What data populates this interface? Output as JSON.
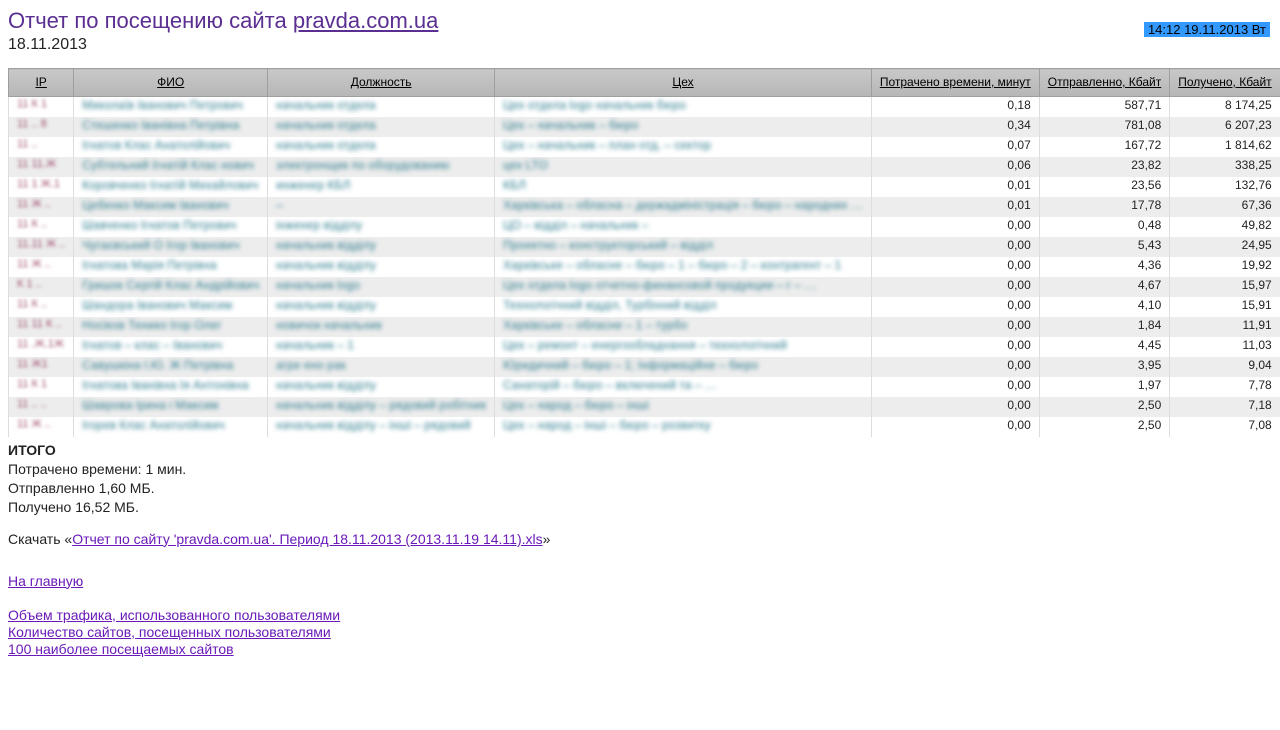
{
  "timestamp": "14:12  19.11.2013  Вт",
  "title_prefix": "Отчет по посещению сайта ",
  "title_site": "pravda.com.ua",
  "report_date": "18.11.2013",
  "columns": {
    "ip": "IP",
    "fio": "ФИО",
    "position": "Должность",
    "department": "Цех",
    "minutes": "Потрачено времени, минут",
    "sent": "Отправленно, Кбайт",
    "recv": "Получено, Кбайт"
  },
  "rows": [
    {
      "ip": "11  К  1",
      "fio": "Миколаїв Іванович Петрович",
      "pos": "начальник отдела",
      "dept": "Цех отдела logo начальник бюро",
      "min": "0,18",
      "sent": "587,71",
      "recv": "8 174,25"
    },
    {
      "ip": "11  ..  8",
      "fio": "Стешенко Іванівна Петрівна",
      "pos": "начальник отдела",
      "dept": "Цех – начальник – бюро",
      "min": "0,34",
      "sent": "781,08",
      "recv": "6 207,23"
    },
    {
      "ip": "11  .. ",
      "fio": "Ігнатов Клас Анатолійович",
      "pos": "начальник отдела",
      "dept": "Цех – начальник – план отд. – сектор",
      "min": "0,07",
      "sent": "167,72",
      "recv": "1 814,62"
    },
    {
      "ip": "11 11.Ж",
      "fio": "Субтельний Ігнатій Клас нович",
      "pos": "электронщик по оборудованию",
      "dept": "цех LTO",
      "min": "0,06",
      "sent": "23,82",
      "recv": "338,25"
    },
    {
      "ip": "11  1  Ж.1",
      "fio": "Коровченко Ігнатій Михайлович",
      "pos": "инженер КБЛ",
      "dept": "КБЛ",
      "min": "0,01",
      "sent": "23,56",
      "recv": "132,76"
    },
    {
      "ip": "11  Ж ..",
      "fio": "Цебенко Максим Іванович",
      "pos": "–",
      "dept": "Харківська – обласна – держадміністрація – бюро – народних …",
      "min": "0,01",
      "sent": "17,78",
      "recv": "67,36"
    },
    {
      "ip": "11  К ..",
      "fio": "Шавченко Ігнатов Петрович",
      "pos": "інженер відділу",
      "dept": "ЦО – відділ – начальник –",
      "min": "0,00",
      "sent": "0,48",
      "recv": "49,82"
    },
    {
      "ip": "11.11 Ж ..",
      "fio": "Чугаєвський О Ігор Іванович",
      "pos": "начальник відділу",
      "dept": "Проектно – конструкторський – відділ",
      "min": "0,00",
      "sent": "5,43",
      "recv": "24,95"
    },
    {
      "ip": "11  Ж ..",
      "fio": "Ігнатова Марія Петрівна",
      "pos": "начальник відділу",
      "dept": "Харківське – обласне – бюро – 1 – бюро – 2 – контрагент – 1",
      "min": "0,00",
      "sent": "4,36",
      "recv": "19,92"
    },
    {
      "ip": "К  1 ..",
      "fio": "Гришок Сергій Клас Андрійович",
      "pos": "начальник logo",
      "dept": "Цех отдела logo отчетно-финансовой продукции – г – …",
      "min": "0,00",
      "sent": "4,67",
      "recv": "15,97"
    },
    {
      "ip": "11  К ..",
      "fio": "Шандора Іванович Максим",
      "pos": "начальник відділу",
      "dept": "Технологічний відділ, Турбінний відділ",
      "min": "0,00",
      "sent": "4,10",
      "recv": "15,91"
    },
    {
      "ip": "11 11 К ..",
      "fio": "Носіков Тенико Ігор Олег",
      "pos": "новичок начальник",
      "dept": "Харківське – обласне – 1 – турбо",
      "min": "0,00",
      "sent": "1,84",
      "recv": "11,91"
    },
    {
      "ip": "11  .Ж.1Ж",
      "fio": "Ігнатов – клас – Іванович",
      "pos": "начальник – 1",
      "dept": "Цех – ремонт – енергообладнання – технологічний",
      "min": "0,00",
      "sent": "4,45",
      "recv": "11,03"
    },
    {
      "ip": "11  Ж1",
      "fio": "Савушкіна І.Ю. Ж Петрівна",
      "pos": "агре ено рак",
      "dept": "Юридичний – бюро – 1; Інформаційне – бюро",
      "min": "0,00",
      "sent": "3,95",
      "recv": "9,04"
    },
    {
      "ip": "11  К  1",
      "fio": "Ігнатова Іванівна Ія Антонівна",
      "pos": "начальник відділу",
      "dept": "Санаторій – бюро – включений та – …",
      "min": "0,00",
      "sent": "1,97",
      "recv": "7,78"
    },
    {
      "ip": "11  .. ..",
      "fio": "Шаврова Ірина і Максим",
      "pos": "начальник відділу – рядовий робітник",
      "dept": "Цех – народ – бюро – інші",
      "min": "0,00",
      "sent": "2,50",
      "recv": "7,18"
    },
    {
      "ip": "11  Ж ..",
      "fio": "Ігорев Клас Анатолійович",
      "pos": "начальник відділу – інші – рядовий",
      "dept": "Цех – народ – інші – бюро – розвитку",
      "min": "0,00",
      "sent": "2,50",
      "recv": "7,08"
    }
  ],
  "summary": {
    "total_label": "ИТОГО",
    "time_line": "Потрачено времени: 1 мин.",
    "sent_line": "Отправленно 1,60 МБ.",
    "recv_line": "Получено 16,52 МБ."
  },
  "download": {
    "prefix": "Скачать «",
    "link_text": "Отчет по сайту 'pravda.com.ua'. Период 18.11.2013 (2013.11.19  14.11).xls",
    "suffix": "»"
  },
  "nav": {
    "home": "На главную",
    "traffic": "Объем трафика, использованного пользователями",
    "sites_count": "Количество сайтов, посещенных пользователями",
    "top100": "100 наиболее посещаемых сайтов"
  }
}
